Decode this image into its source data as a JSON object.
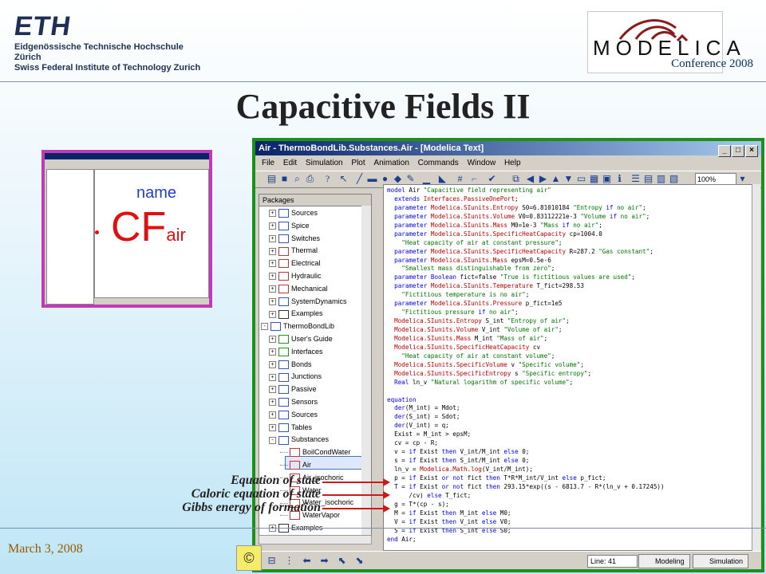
{
  "header": {
    "eth_logo_text": "ETH",
    "eth_line1": "Eidgenössische Technische Hochschule Zürich",
    "eth_line2": "Swiss Federal Institute of Technology Zurich",
    "modelica_logo_text": "MODELICA",
    "conference": "Conference 2008"
  },
  "slide": {
    "title": "Capacitive Fields II",
    "date": "March 3, 2008",
    "copyright_glyph": "©"
  },
  "thumbnail": {
    "name_label": "name",
    "cf_label": "CF",
    "cf_subscript": "air"
  },
  "window": {
    "title": "Air - ThermoBondLib.Substances.Air - [Modelica Text]",
    "buttons": {
      "minimize": "_",
      "maximize": "□",
      "close": "×"
    },
    "menu": [
      "File",
      "Edit",
      "Simulation",
      "Plot",
      "Animation",
      "Commands",
      "Window",
      "Help"
    ],
    "zoom": "100%",
    "tree_header": "Packages",
    "tree_items": [
      {
        "label": "Sources",
        "node": "+",
        "color": "#3355cc"
      },
      {
        "label": "Spice",
        "node": "+",
        "color": "#3355cc"
      },
      {
        "label": "Switches",
        "node": "+",
        "color": "#3355cc"
      },
      {
        "label": "Thermal",
        "node": "+",
        "color": "#cc3333"
      },
      {
        "label": "Electrical",
        "node": "+",
        "color": "#cc3333"
      },
      {
        "label": "Hydraulic",
        "node": "+",
        "color": "#cc3333"
      },
      {
        "label": "Mechanical",
        "node": "+",
        "color": "#cc3333"
      },
      {
        "label": "SystemDynamics",
        "node": "+",
        "color": "#3355cc"
      },
      {
        "label": "Examples",
        "node": "+",
        "color": "#333333"
      },
      {
        "label": "ThermoBondLib",
        "node": "-",
        "color": "#3355cc"
      },
      {
        "label": "User's Guide",
        "node": "+",
        "color": "#1a9a1a"
      },
      {
        "label": "Interfaces",
        "node": "+",
        "color": "#1a9a1a"
      },
      {
        "label": "Bonds",
        "node": "+",
        "color": "#3355cc"
      },
      {
        "label": "Junctions",
        "node": "+",
        "color": "#3355cc"
      },
      {
        "label": "Passive",
        "node": "+",
        "color": "#3355cc"
      },
      {
        "label": "Sensors",
        "node": "+",
        "color": "#3355cc"
      },
      {
        "label": "Sources",
        "node": "+",
        "color": "#3355cc"
      },
      {
        "label": "Tables",
        "node": "+",
        "color": "#3355cc"
      },
      {
        "label": "Substances",
        "node": "-",
        "color": "#3355cc"
      },
      {
        "label": "BoilCondWater",
        "node": "",
        "color": "#cc3333"
      },
      {
        "label": "Air",
        "node": "",
        "color": "#cc3333"
      },
      {
        "label": "Air_isochoric",
        "node": "",
        "color": "#cc3333"
      },
      {
        "label": "Water",
        "node": "",
        "color": "#cc3333"
      },
      {
        "label": "Water_isochoric",
        "node": "",
        "color": "#cc3333"
      },
      {
        "label": "WaterVapor",
        "node": "",
        "color": "#cc3333"
      },
      {
        "label": "Examples",
        "node": "+",
        "color": "#333333"
      }
    ],
    "code_lines": [
      "model Air \"Capacitive field representing air\"",
      "  extends Interfaces.PassiveOnePort;",
      "  parameter Modelica.SIunits.Entropy S0=6.81010184 \"Entropy if no air\";",
      "  parameter Modelica.SIunits.Volume V0=0.83112221e-3 \"Volume if no air\";",
      "  parameter Modelica.SIunits.Mass M0=1e-3 \"Mass if no air\";",
      "  parameter Modelica.SIunits.SpecificHeatCapacity cp=1004.0",
      "    \"Heat capacity of air at constant pressure\";",
      "  parameter Modelica.SIunits.SpecificHeatCapacity R=287.2 \"Gas constant\";",
      "  parameter Modelica.SIunits.Mass epsM=0.5e-6",
      "    \"Smallest mass distinguishable from zero\";",
      "  parameter Boolean fict=false \"True is fictitious values are used\";",
      "  parameter Modelica.SIunits.Temperature T_fict=298.53",
      "    \"Fictitious temperature is no air\";",
      "  parameter Modelica.SIunits.Pressure p_fict=1e5",
      "    \"Fictitious pressure if no air\";",
      "  Modelica.SIunits.Entropy S_int \"Entropy of air\";",
      "  Modelica.SIunits.Volume V_int \"Volume of air\";",
      "  Modelica.SIunits.Mass M_int \"Mass of air\";",
      "  Modelica.SIunits.SpecificHeatCapacity cv",
      "    \"Heat capacity of air at constant volume\";",
      "  Modelica.SIunits.SpecificVolume v \"Specific volume\";",
      "  Modelica.SIunits.SpecificEntropy s \"Specific entropy\";",
      "  Real ln_v \"Natural logarithm of specific volume\";",
      "",
      "equation",
      "  der(M_int) = Mdot;",
      "  der(S_int) = Sdot;",
      "  der(V_int) = q;",
      "  Exist = M_int > epsM;",
      "  cv = cp - R;",
      "  v = if Exist then V_int/M_int else 0;",
      "  s = if Exist then S_int/M_int else 0;",
      "  ln_v = Modelica.Math.log(V_int/M_int);",
      "  p = if Exist or not fict then T*R*M_int/V_int else p_fict;",
      "  T = if Exist or not fict then 293.15*exp((s - 6813.7 - R*(ln_v + 0.17245))",
      "      /cv) else T_fict;",
      "  g = T*(cp - s);",
      "  M = if Exist then M_int else M0;",
      "  V = if Exist then V_int else V0;",
      "  S = if Exist then S_int else S0;",
      "end Air;"
    ],
    "line_label": "Line: 41",
    "tab_modeling": "Modeling",
    "tab_simulation": "Simulation"
  },
  "annotations": [
    "Equation of state",
    "Caloric equation of state",
    "Gibbs energy of formation"
  ],
  "colors": {
    "window_border": "#1c8f1c",
    "thumbnail_border": "#c03bb8",
    "arrow": "#cc1a1a",
    "keyword": "#0000ff",
    "type": "#c00000"
  }
}
